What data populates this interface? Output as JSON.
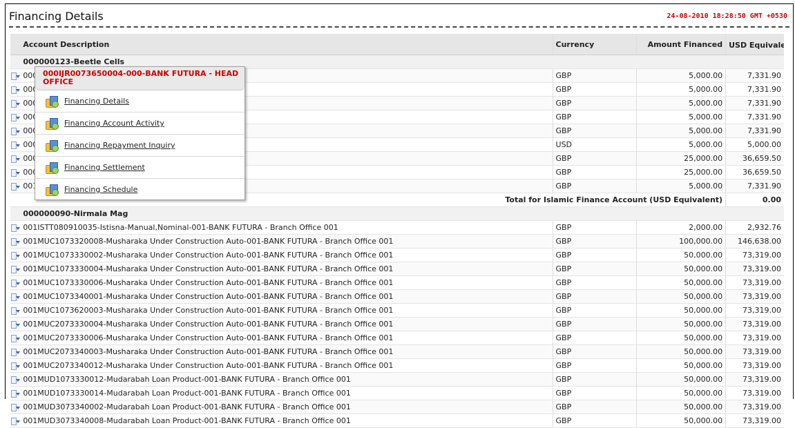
{
  "page": {
    "title": "Financing Details",
    "timestamp": "24-08-2010 18:28:50 GMT +0530"
  },
  "table": {
    "headers": {
      "account_description": "Account Description",
      "currency": "Currency",
      "amount_financed": "Amount Financed",
      "usd_equivalent": "USD Equivalent"
    },
    "group1_name": "000000123-Beetle Cells",
    "group1_rows": [
      {
        "desc": "000IJR0073650004-000-BANK FUTURA - HEAD OFFICE",
        "currency": "GBP",
        "amount": "5,000.00",
        "usd": "7,331.90"
      },
      {
        "desc": "000IJR0073650005-000-BANK FUTURA - HEAD OFFICE",
        "currency": "GBP",
        "amount": "5,000.00",
        "usd": "7,331.90"
      },
      {
        "desc": "000IJR0073650006-000-BANK FUTURA - HEAD OFFICE",
        "currency": "GBP",
        "amount": "5,000.00",
        "usd": "7,331.90"
      },
      {
        "desc": "000IJR0073650007-000-BANK FUTURA - HEAD OFFICE",
        "currency": "GBP",
        "amount": "5,000.00",
        "usd": "7,331.90"
      },
      {
        "desc": "000IJR007365008-000-BANK FUTURA - HEAD OFFICE",
        "currency": "GBP",
        "amount": "5,000.00",
        "usd": "7,331.90"
      },
      {
        "desc": "000IJR007365009-000-BANK FUTURA - HEAD OFFICE",
        "currency": "USD",
        "amount": "5,000.00",
        "usd": "5,000.00"
      },
      {
        "desc": "000IJR007365010-000-BANK FUTURA - HEAD OFFICE",
        "currency": "GBP",
        "amount": "25,000.00",
        "usd": "36,659.50"
      },
      {
        "desc": "000IJR007365011-000-BANK FUTURA - HEAD OFFICE",
        "currency": "GBP",
        "amount": "25,000.00",
        "usd": "36,659.50"
      },
      {
        "desc": "001IJR0073650012-001-BANK FUTURA - Branch Office 001",
        "currency": "GBP",
        "amount": "5,000.00",
        "usd": "7,331.90"
      }
    ],
    "total_label": "Total for Islamic Finance Account  (USD Equivalent)",
    "total_value": "0.00",
    "group2_name": "000000090-Nirmala Mag",
    "group2_rows": [
      {
        "desc": "001ISTT080910035-Istisna-Manual,Nominal-001-BANK FUTURA - Branch Office 001",
        "currency": "GBP",
        "amount": "2,000.00",
        "usd": "2,932.76"
      },
      {
        "desc": "001MUC1073320008-Musharaka Under Construction Auto-001-BANK FUTURA - Branch Office 001",
        "currency": "GBP",
        "amount": "100,000.00",
        "usd": "146,638.00"
      },
      {
        "desc": "001MUC1073330002-Musharaka Under Construction Auto-001-BANK FUTURA - Branch Office 001",
        "currency": "GBP",
        "amount": "50,000.00",
        "usd": "73,319.00"
      },
      {
        "desc": "001MUC1073330004-Musharaka Under Construction Auto-001-BANK FUTURA - Branch Office 001",
        "currency": "GBP",
        "amount": "50,000.00",
        "usd": "73,319.00"
      },
      {
        "desc": "001MUC1073330006-Musharaka Under Construction Auto-001-BANK FUTURA - Branch Office 001",
        "currency": "GBP",
        "amount": "50,000.00",
        "usd": "73,319.00"
      },
      {
        "desc": "001MUC1073340001-Musharaka Under Construction Auto-001-BANK FUTURA - Branch Office 001",
        "currency": "GBP",
        "amount": "50,000.00",
        "usd": "73,319.00"
      },
      {
        "desc": "001MUC1073620003-Musharaka Under Construction Auto-001-BANK FUTURA - Branch Office 001",
        "currency": "GBP",
        "amount": "50,000.00",
        "usd": "73,319.00"
      },
      {
        "desc": "001MUC2073330004-Musharaka Under Construction Auto-001-BANK FUTURA - Branch Office 001",
        "currency": "GBP",
        "amount": "50,000.00",
        "usd": "73,319.00"
      },
      {
        "desc": "001MUC2073330006-Musharaka Under Construction Auto-001-BANK FUTURA - Branch Office 001",
        "currency": "GBP",
        "amount": "50,000.00",
        "usd": "73,319.00"
      },
      {
        "desc": "001MUC2073340003-Musharaka Under Construction Auto-001-BANK FUTURA - Branch Office 001",
        "currency": "GBP",
        "amount": "50,000.00",
        "usd": "73,319.00"
      },
      {
        "desc": "001MUC2073340012-Musharaka Under Construction Auto-001-BANK FUTURA - Branch Office 001",
        "currency": "GBP",
        "amount": "50,000.00",
        "usd": "73,319.00"
      },
      {
        "desc": "001MUD1073330012-Mudarabah Loan Product-001-BANK FUTURA - Branch Office 001",
        "currency": "GBP",
        "amount": "50,000.00",
        "usd": "73,319.00"
      },
      {
        "desc": "001MUD1073330014-Mudarabah Loan Product-001-BANK FUTURA - Branch Office 001",
        "currency": "GBP",
        "amount": "50,000.00",
        "usd": "73,319.00"
      },
      {
        "desc": "001MUD3073340002-Mudarabah Loan Product-001-BANK FUTURA - Branch Office 001",
        "currency": "GBP",
        "amount": "50,000.00",
        "usd": "73,319.00"
      },
      {
        "desc": "001MUD3073340008-Mudarabah Loan Product-001-BANK FUTURA - Branch Office 001",
        "currency": "GBP",
        "amount": "50,000.00",
        "usd": "73,319.00"
      }
    ]
  },
  "context_menu": {
    "header": "000IJR0073650004-000-BANK FUTURA - HEAD OFFICE",
    "items": [
      {
        "label": "Financing Details",
        "icon": "financing-details-icon"
      },
      {
        "label": "Financing Account Activity",
        "icon": "financing-account-activity-icon"
      },
      {
        "label": "Financing Repayment Inquiry",
        "icon": "financing-repayment-inquiry-icon"
      },
      {
        "label": "Financing Settlement",
        "icon": "financing-settlement-icon"
      },
      {
        "label": "Financing Schedule",
        "icon": "financing-schedule-icon"
      }
    ]
  }
}
